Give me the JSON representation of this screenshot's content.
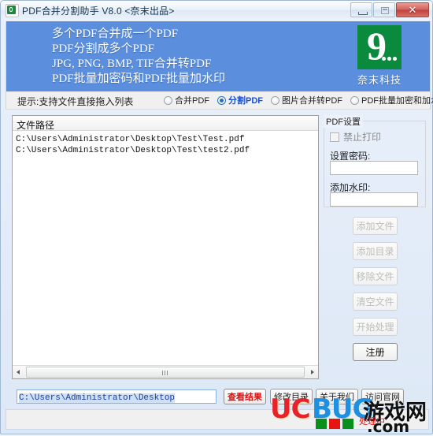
{
  "window": {
    "title": "PDF合并分割助手 V8.0 <奈末出品>",
    "icon": "pdf-app-icon",
    "controls": {
      "minimize": "—",
      "maximize": "□",
      "close": "✕"
    }
  },
  "banner": {
    "lines": [
      "多个PDF合并成一个PDF",
      "PDF分割成多个PDF",
      "JPG, PNG, BMP, TIF合并转PDF",
      "PDF批量加密码和PDF批量加水印"
    ],
    "logo": {
      "glyph": "9",
      "caption": "奈末科技",
      "color": "#0a8a3c"
    },
    "background": "#5b8fdd"
  },
  "tip": {
    "text": "提示:支持文件直接拖入列表"
  },
  "modes": [
    {
      "label": "合并PDF",
      "selected": false
    },
    {
      "label": "分割PDF",
      "selected": true
    },
    {
      "label": "图片合并转PDF",
      "selected": false
    },
    {
      "label": "PDF批量加密和加水印",
      "selected": false
    }
  ],
  "file_list": {
    "column_header": "文件路径",
    "rows": [
      "C:\\Users\\Administrator\\Desktop\\Test\\Test.pdf",
      "C:\\Users\\Administrator\\Desktop\\Test\\test2.pdf"
    ]
  },
  "pdf_settings": {
    "group_title": "PDF设置",
    "disable_print": {
      "label": "禁止打印",
      "checked": false
    },
    "password": {
      "label": "设置密码:",
      "value": "",
      "placeholder": ""
    },
    "watermark": {
      "label": "添加水印:",
      "value": "",
      "placeholder": ""
    }
  },
  "actions": [
    {
      "label": "添加文件",
      "enabled": false
    },
    {
      "label": "添加目录",
      "enabled": false
    },
    {
      "label": "移除文件",
      "enabled": false
    },
    {
      "label": "清空文件",
      "enabled": false
    },
    {
      "label": "开始处理",
      "enabled": false
    },
    {
      "label": "注册",
      "enabled": true
    }
  ],
  "bottom": {
    "output_path": "C:\\Users\\Administrator\\Desktop",
    "view_result": "查看结果",
    "change_dir": "修改目录",
    "about_us": "关于我们",
    "visit_site": "访问官网"
  },
  "watermark": {
    "uc": "UC",
    "bug": "BUG",
    "zh": "游戏网",
    "com": ".com",
    "processing": "处理中",
    "flag_colors": [
      "#0a8f1a",
      "#e81414",
      "#0a8f1a"
    ]
  }
}
